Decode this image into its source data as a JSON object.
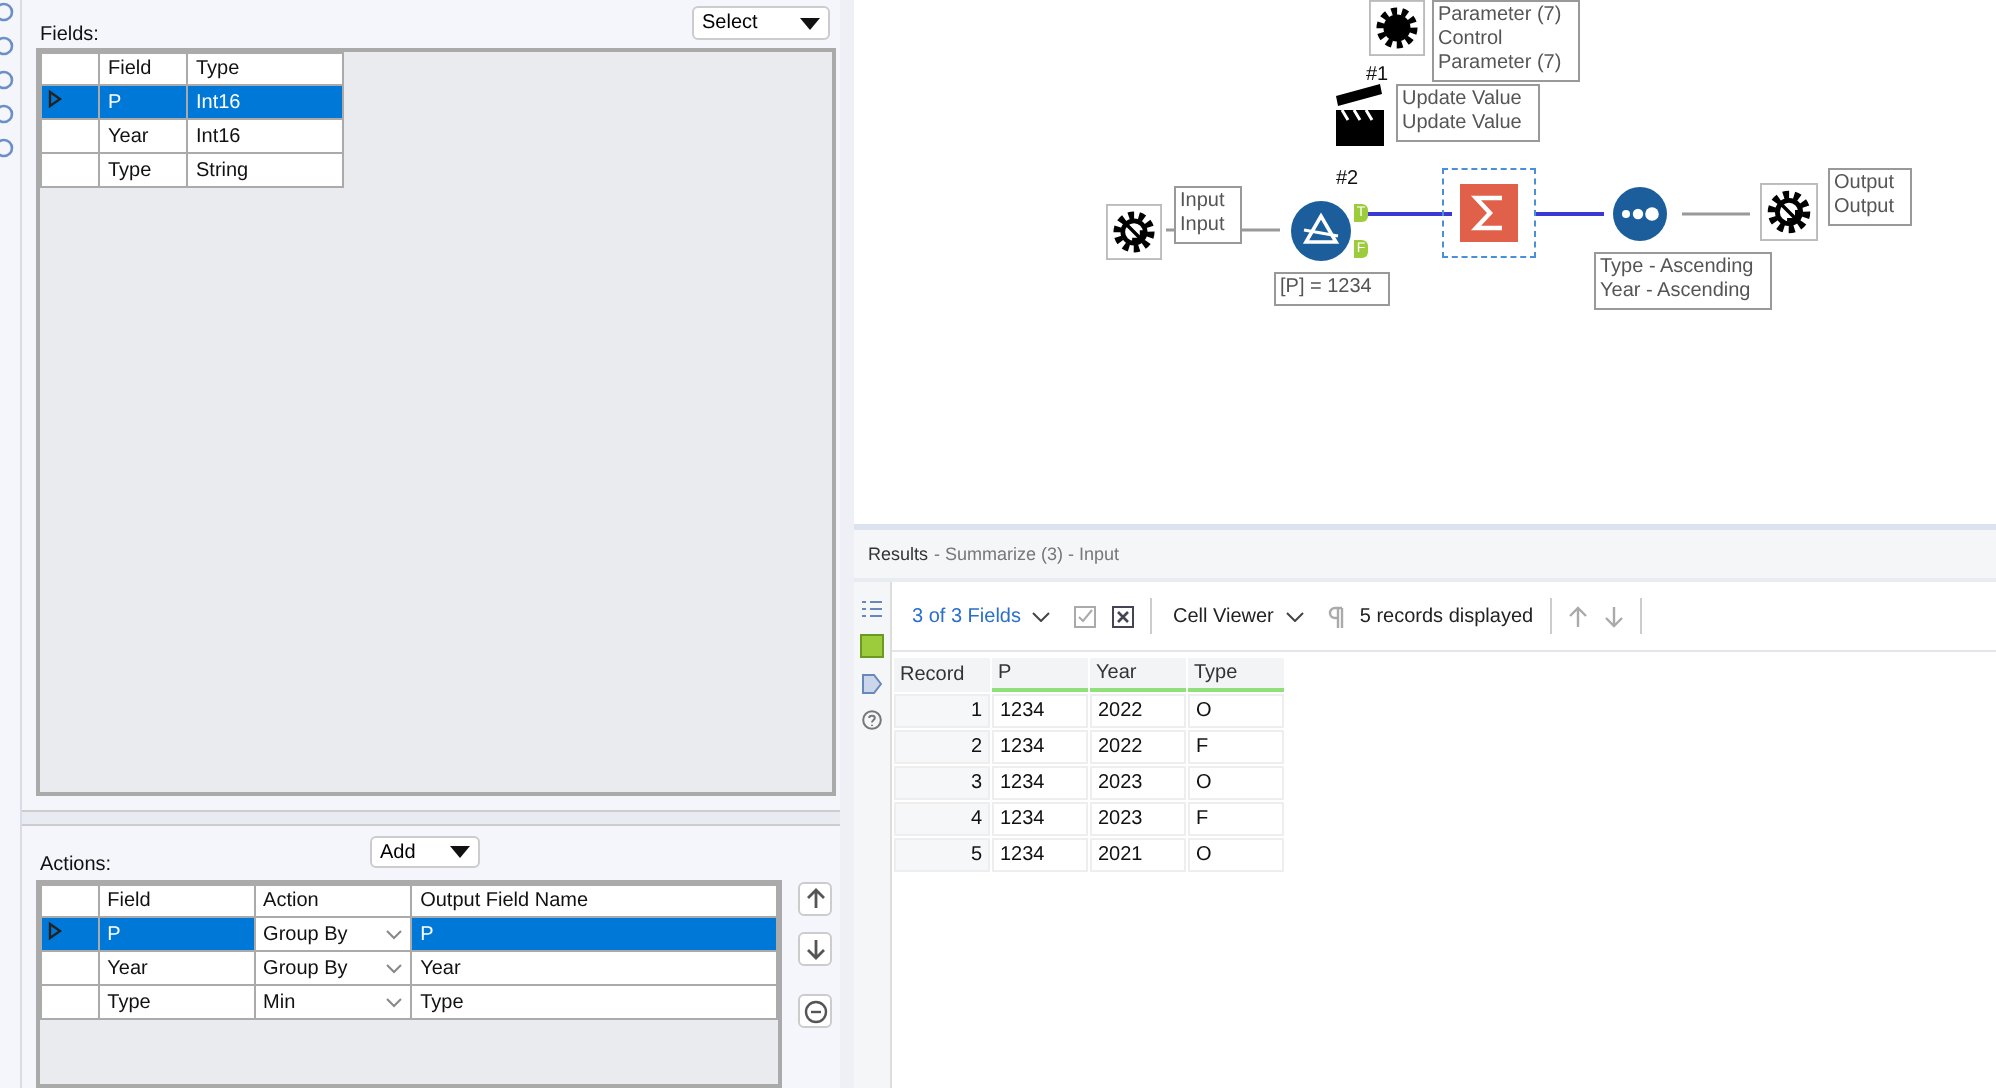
{
  "fields_panel": {
    "label": "Fields:",
    "select_button": "Select",
    "columns": [
      "Field",
      "Type"
    ],
    "rows": [
      {
        "field": "P",
        "type": "Int16",
        "selected": true
      },
      {
        "field": "Year",
        "type": "Int16",
        "selected": false
      },
      {
        "field": "Type",
        "type": "String",
        "selected": false
      }
    ]
  },
  "actions_panel": {
    "label": "Actions:",
    "add_button": "Add",
    "columns": [
      "Field",
      "Action",
      "Output Field Name"
    ],
    "rows": [
      {
        "field": "P",
        "action": "Group By",
        "output": "P",
        "selected": true
      },
      {
        "field": "Year",
        "action": "Group By",
        "output": "Year",
        "selected": false
      },
      {
        "field": "Type",
        "action": "Min",
        "output": "Type",
        "selected": false
      }
    ]
  },
  "canvas": {
    "tools": [
      {
        "kind": "control-param",
        "labels": [
          "Parameter (7)",
          "Control",
          "Parameter (7)"
        ]
      },
      {
        "kind": "action",
        "badge": "#1",
        "labels": [
          "Update Value",
          "Update Value"
        ]
      },
      {
        "kind": "input",
        "labels": [
          "Input",
          "Input"
        ]
      },
      {
        "kind": "filter",
        "badge": "#2",
        "labels": [
          "[P] = 1234"
        ],
        "anchors": [
          "T",
          "F"
        ]
      },
      {
        "kind": "summarize",
        "selected": true
      },
      {
        "kind": "sort",
        "labels": [
          "Type - Ascending",
          "Year - Ascending"
        ]
      },
      {
        "kind": "output",
        "labels": [
          "Output",
          "Output"
        ]
      }
    ]
  },
  "results": {
    "title": "Results",
    "subtitle": "- Summarize (3) - Input",
    "fields_menu": "3 of 3 Fields",
    "viewer": "Cell Viewer",
    "count": "5 records displayed",
    "columns": [
      "Record",
      "P",
      "Year",
      "Type"
    ],
    "rows": [
      [
        "1",
        "1234",
        "2022",
        "O"
      ],
      [
        "2",
        "1234",
        "2022",
        "F"
      ],
      [
        "3",
        "1234",
        "2023",
        "O"
      ],
      [
        "4",
        "1234",
        "2023",
        "F"
      ],
      [
        "5",
        "1234",
        "2021",
        "O"
      ]
    ]
  }
}
